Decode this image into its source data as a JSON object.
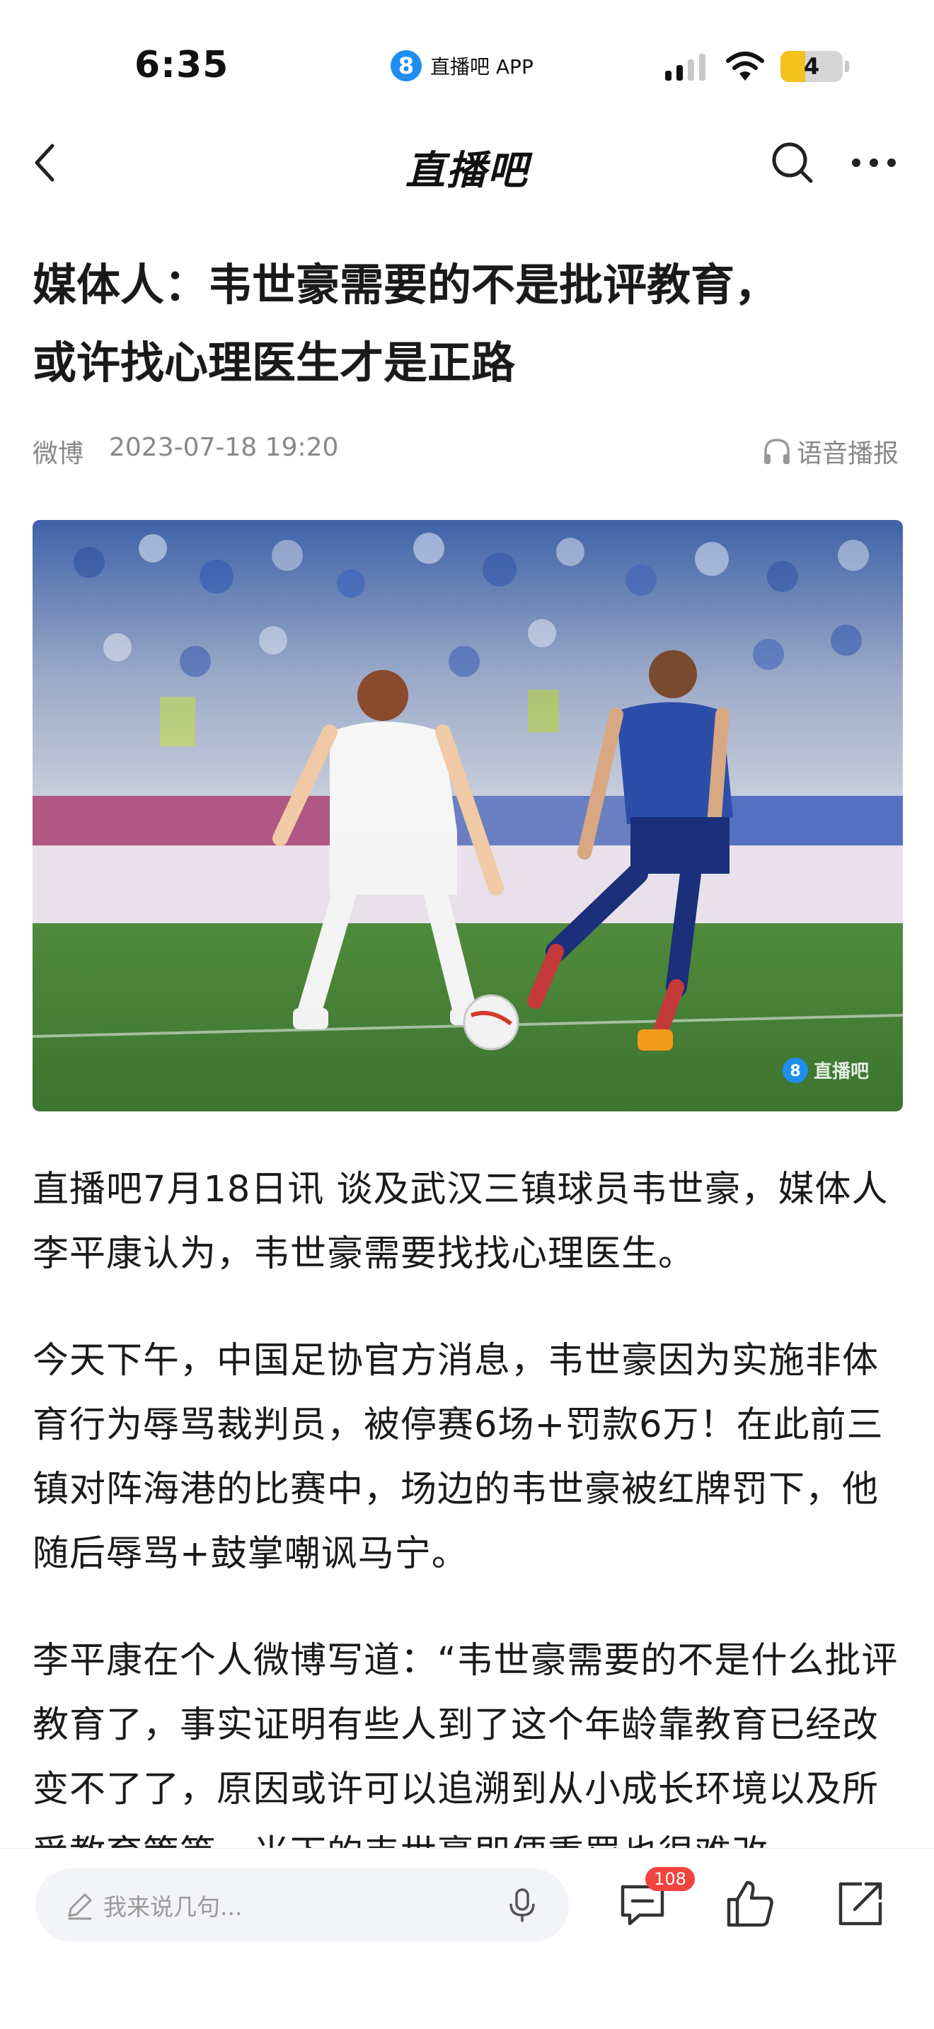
{
  "status_bar": {
    "time": "6:35",
    "app_logo": "8",
    "app_name": "直播吧 APP",
    "battery": "4",
    "battery_level": 0.4,
    "signal_bars_active": 2,
    "signal_bars_total": 4
  },
  "nav": {
    "title": "直播吧",
    "back_icon": "chevron-left-icon",
    "search_icon": "search-icon",
    "more_icon": "more-icon"
  },
  "article": {
    "title_line1": "媒体人：韦世豪需要的不是批评教育，",
    "title_line2": "或许找心理医生才是正路",
    "source": "微博",
    "date": "2023-07-18 19:20",
    "audio_label": "语音播报",
    "image_watermark": "直播吧",
    "paragraphs": [
      "直播吧7月18日讯  谈及武汉三镇球员韦世豪，媒体人李平康认为，韦世豪需要找找心理医生。",
      "今天下午，中国足协官方消息，韦世豪因为实施非体育行为辱骂裁判员，被停赛6场+罚款6万！在此前三镇对阵海港的比赛中，场边的韦世豪被红牌罚下，他随后辱骂+鼓掌嘲讽马宁。",
      "李平康在个人微博写道：“韦世豪需要的不是什么批评教育了，事实证明有些人到了这个年龄靠教育已经改变不了了，原因或许可以追溯到从小成长环境以及所受教育策等，当下的韦世豪即便重罚也很难改"
    ]
  },
  "bottom_bar": {
    "comment_placeholder": "我来说几句...",
    "comment_count": "108"
  },
  "colors": {
    "accent_blue": "#1f8ef1",
    "badge_red": "#f0443f",
    "battery_yellow": "#f3c21c"
  }
}
